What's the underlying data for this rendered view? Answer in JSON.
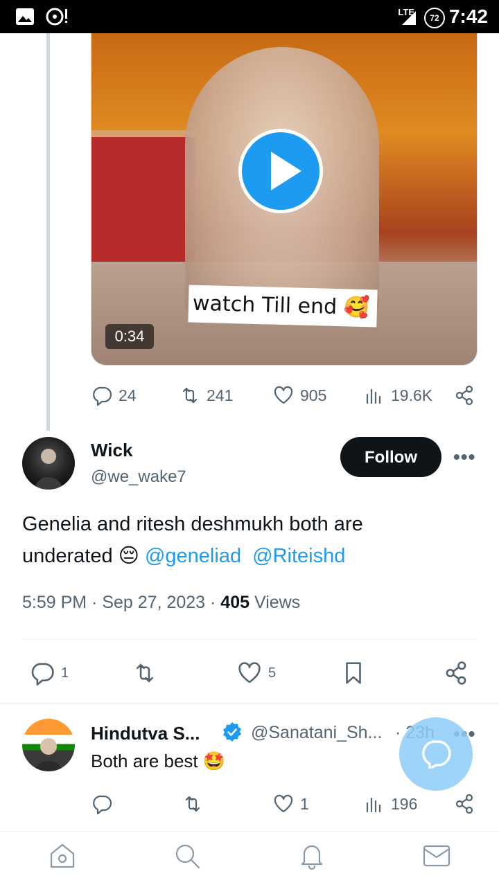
{
  "status_bar": {
    "time": "7:42",
    "network": "LTE",
    "battery": "72"
  },
  "video": {
    "caption": "watch Till end",
    "caption_emoji": "🥰",
    "duration": "0:34"
  },
  "parent_actions": {
    "replies": "24",
    "retweets": "241",
    "likes": "905",
    "views": "19.6K"
  },
  "tweet": {
    "name": "Wick",
    "handle": "@we_wake7",
    "follow_label": "Follow",
    "text": "Genelia and ritesh deshmukh both are underated",
    "emoji": "😔",
    "mentions": [
      "@geneliad",
      "@Riteishd"
    ],
    "time": "5:59 PM",
    "date": "Sep 27, 2023",
    "views_count": "405",
    "views_label": "Views",
    "replies": "1",
    "likes": "5"
  },
  "reply": {
    "name": "Hindutva S...",
    "handle": "@Sanatani_Sh...",
    "age": "23h",
    "text": "Both are best",
    "emoji": "🤩",
    "replies": "",
    "likes": "1",
    "views": "196"
  },
  "icons": {
    "verified_color": "#1d9bf0",
    "accent": "#1d9bf0"
  }
}
